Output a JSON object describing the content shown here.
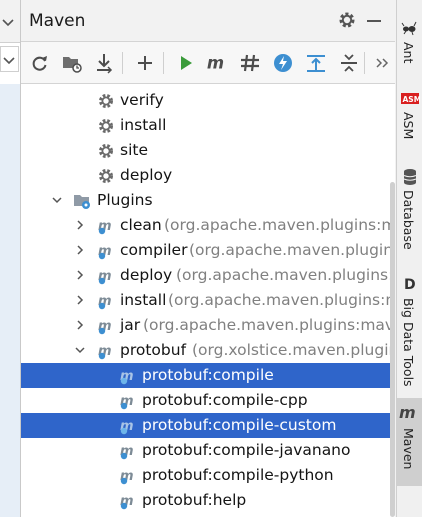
{
  "panel": {
    "title": "Maven"
  },
  "tree": {
    "rows": [
      {
        "label": "verify"
      },
      {
        "label": "install"
      },
      {
        "label": "site"
      },
      {
        "label": "deploy"
      },
      {
        "label": "Plugins"
      },
      {
        "label": "clean",
        "detail": "(org.apache.maven.plugins:maven"
      },
      {
        "label": "compiler",
        "detail": "(org.apache.maven.plugins:mav"
      },
      {
        "label": "deploy",
        "detail": "(org.apache.maven.plugins:ma"
      },
      {
        "label": "install",
        "detail": "(org.apache.maven.plugins:mav"
      },
      {
        "label": "jar",
        "detail": "(org.apache.maven.plugins:maven-"
      },
      {
        "label": "protobuf",
        "detail": "(org.xolstice.maven.plugins:p"
      },
      {
        "label": "protobuf:compile",
        "selected": true
      },
      {
        "label": "protobuf:compile-cpp"
      },
      {
        "label": "protobuf:compile-custom",
        "selected": true
      },
      {
        "label": "protobuf:compile-javanano"
      },
      {
        "label": "protobuf:compile-python"
      },
      {
        "label": "protobuf:help"
      }
    ]
  },
  "right_strip": {
    "tabs": [
      {
        "label": "Ant",
        "icon": "ant-icon"
      },
      {
        "label": "ASM",
        "icon": "asm-icon"
      },
      {
        "label": "Database",
        "icon": "database-icon"
      },
      {
        "label": "Big Data Tools",
        "icon": "big-data-tools-icon"
      },
      {
        "label": "Maven",
        "icon": "maven-icon",
        "active": true
      }
    ]
  },
  "colors": {
    "selection": "#2f65ca",
    "run_green": "#3a9b3a",
    "plugin_blue": "#3d8fd1",
    "asm_red": "#d92020"
  }
}
